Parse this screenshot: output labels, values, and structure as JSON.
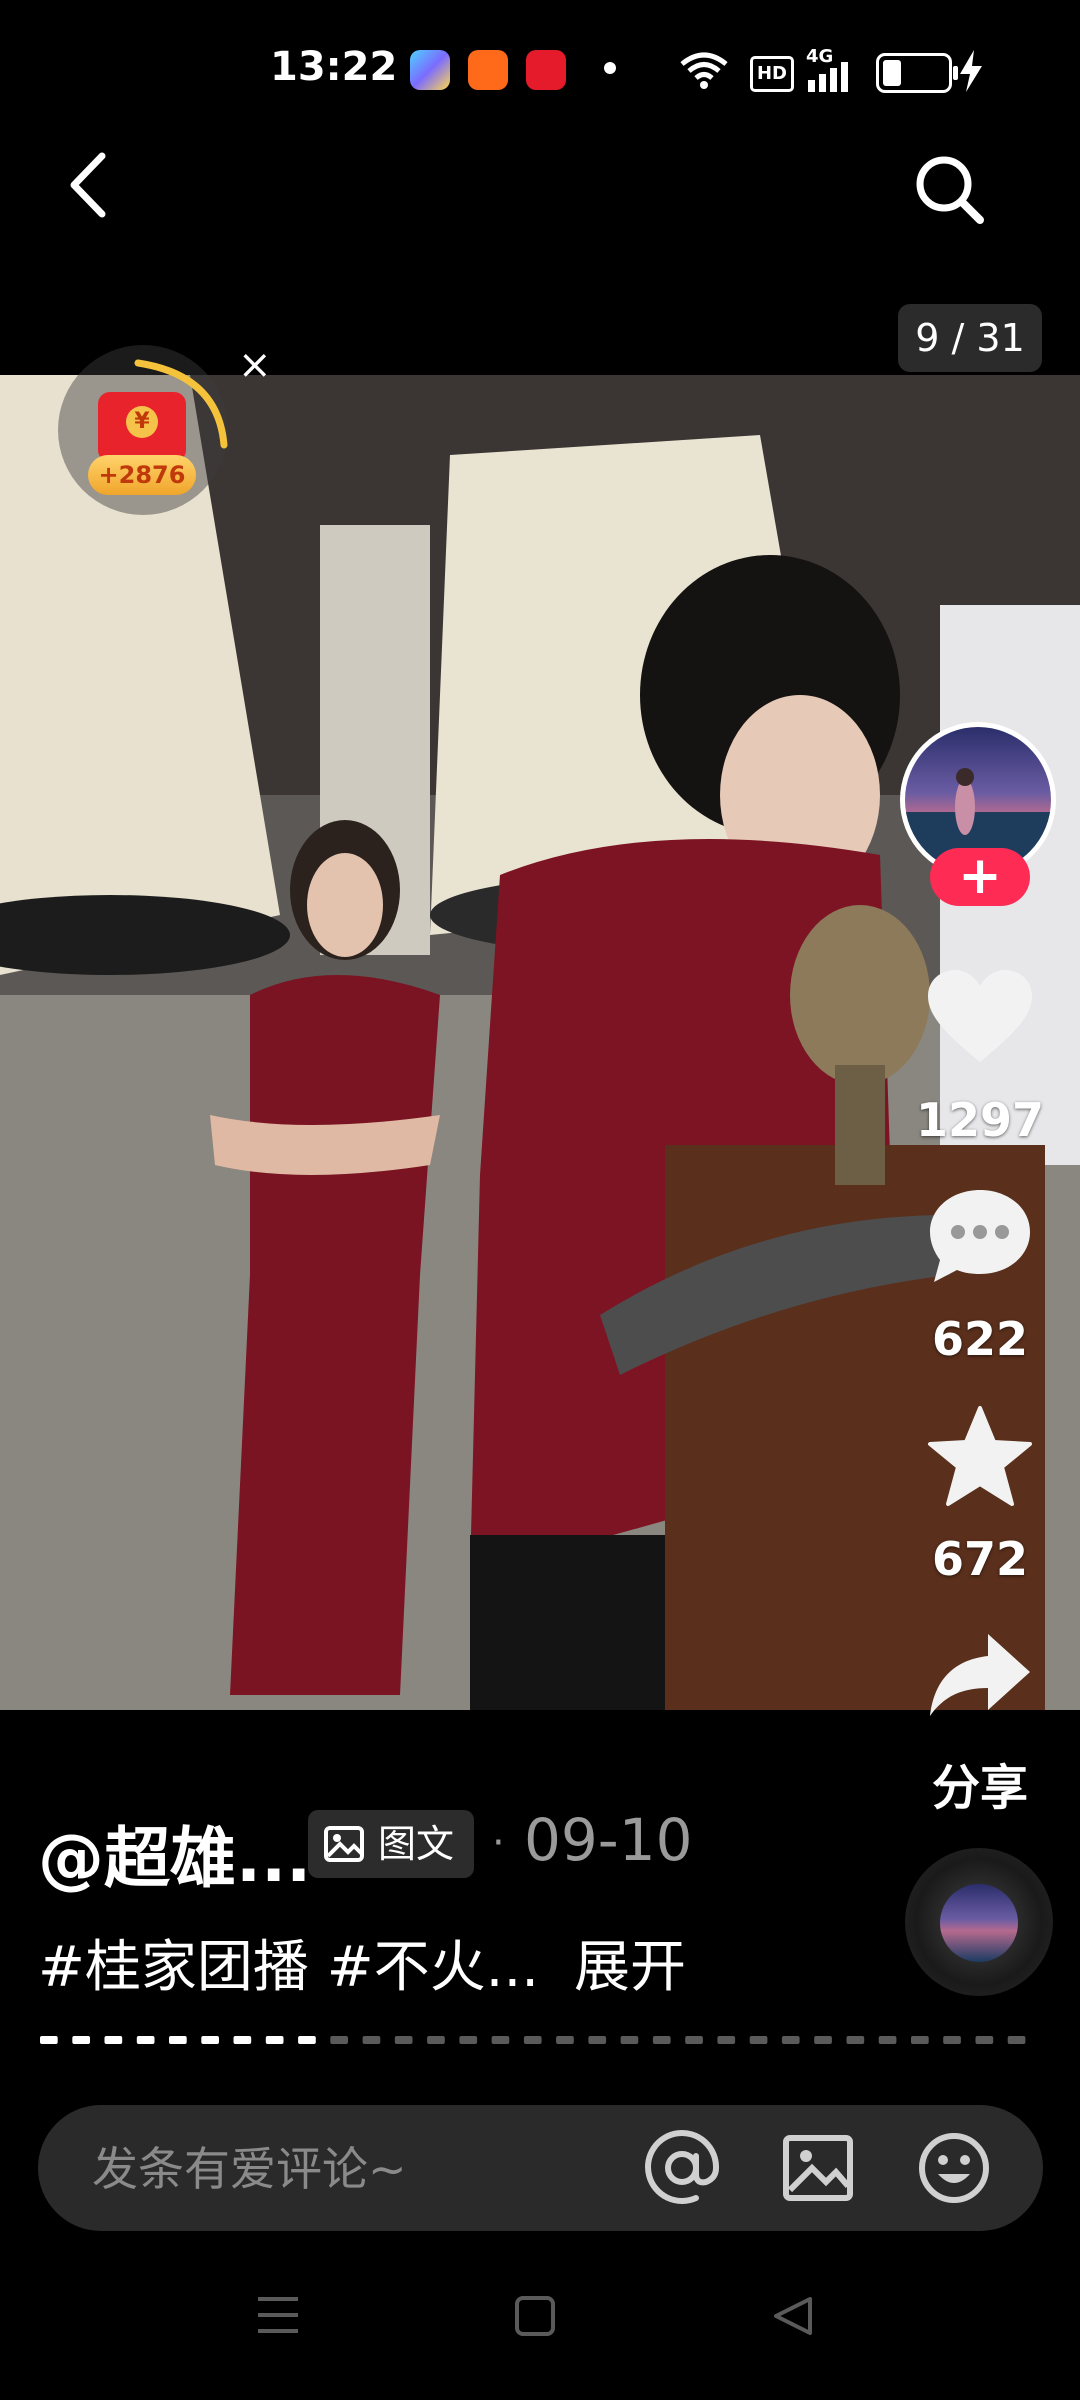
{
  "status_bar": {
    "time": "13:22",
    "app_icons": [
      "app-icon-1",
      "app-icon-2",
      "app-icon-3"
    ],
    "network": "4G",
    "hd_badge": "HD",
    "icons": [
      "wifi-icon",
      "hd-icon",
      "signal-icon",
      "battery-icon",
      "charging-icon"
    ]
  },
  "header": {
    "back_icon": "chevron-left-icon",
    "search_icon": "search-icon"
  },
  "gallery": {
    "counter": "9 / 31"
  },
  "red_packet": {
    "coin_symbol": "¥",
    "reward": "+2876",
    "close_glyph": "×"
  },
  "actions": {
    "like_count": "1297",
    "comment_count": "622",
    "favorite_count": "672",
    "share_label": "分享",
    "follow_glyph": "+"
  },
  "post": {
    "author": "@超雄...",
    "type_badge": "图文",
    "separator": "·",
    "date": "09-10",
    "caption": "#桂家团播 #不火...",
    "expand_label": "展开",
    "progress": 0.29
  },
  "comment_bar": {
    "placeholder": "发条有爱评论~",
    "icons": [
      "at-icon",
      "image-icon",
      "emoji-icon"
    ]
  },
  "nav_bar": {
    "icons": [
      "menu-icon",
      "home-icon",
      "back-triangle-icon"
    ]
  },
  "colors": {
    "accent": "#fe2c55",
    "background": "#000000",
    "muted": "#9a9a9a"
  }
}
